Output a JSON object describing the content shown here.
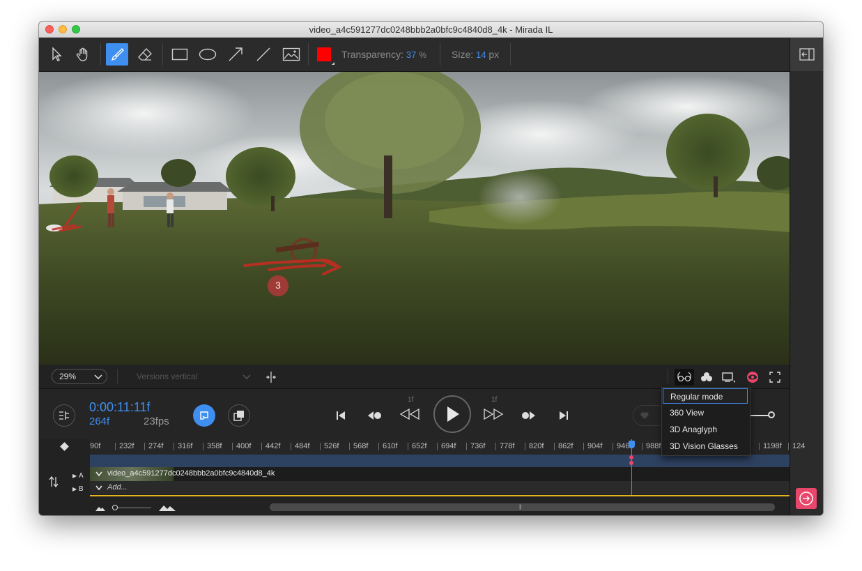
{
  "window": {
    "title": "video_a4c591277dc0248bbb2a0bfc9c4840d8_4k - Mirada IL"
  },
  "toolbar": {
    "tools": [
      "select-tool",
      "hand-tool",
      "brush-tool",
      "eraser-tool",
      "rectangle-tool",
      "ellipse-tool",
      "arrow-tool",
      "line-tool",
      "image-tool"
    ],
    "color": "#ff0000",
    "transparency_label": "Transparency:",
    "transparency_value": "37",
    "transparency_unit": "%",
    "size_label": "Size:",
    "size_value": "14",
    "size_unit": "px"
  },
  "viewer": {
    "annotation_number": "3"
  },
  "view_bar": {
    "zoom": "29%",
    "versions_placeholder": "Versions vertical"
  },
  "view_mode_menu": {
    "items": [
      "Regular mode",
      "360 View",
      "3D Anaglyph",
      "3D Vision Glasses"
    ],
    "selected": "Regular mode"
  },
  "transport": {
    "timecode": "0:00:11:11f",
    "frame": "264f",
    "fps": "23fps",
    "step_back_label": "1f",
    "step_fwd_label": "1f"
  },
  "timeline": {
    "ticks": [
      "90f",
      "232f",
      "274f",
      "316f",
      "358f",
      "400f",
      "442f",
      "484f",
      "526f",
      "568f",
      "610f",
      "652f",
      "694f",
      "736f",
      "778f",
      "820f",
      "862f",
      "904f",
      "946f",
      "988f",
      "1030f",
      "",
      "",
      "1198f",
      "124"
    ],
    "tracks": [
      {
        "letter": "A",
        "name": "video_a4c591277dc0248bbb2a0bfc9c4840d8_4k"
      },
      {
        "letter": "B",
        "name": "Add..."
      }
    ]
  },
  "colors": {
    "accent": "#3f8ff0",
    "panel": "#2b2b2b",
    "exit": "#e8466b",
    "marker": "#e6b422"
  }
}
